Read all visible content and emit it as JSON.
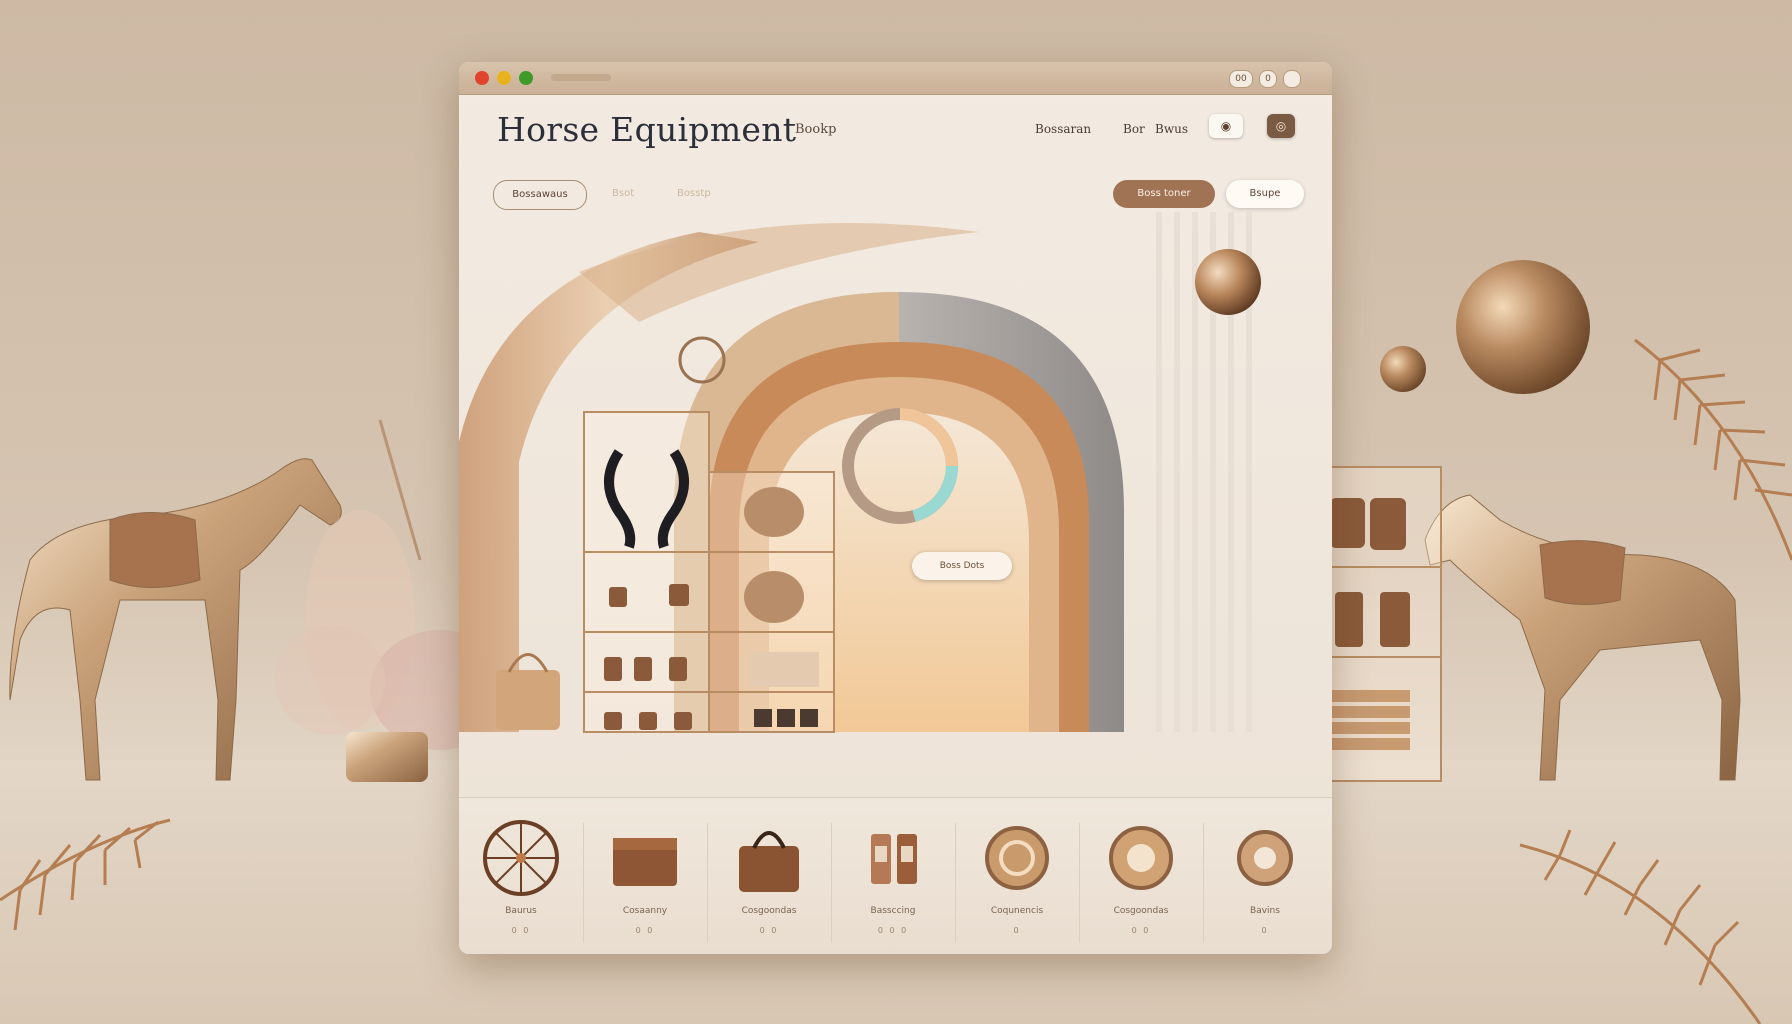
{
  "window": {
    "title": "",
    "controls": [
      "close",
      "minimize",
      "maximize"
    ],
    "toolbar_buttons": [
      {
        "label": "00",
        "icon": "tab-icon"
      },
      {
        "label": "0",
        "icon": "refresh-icon"
      },
      {
        "label": "",
        "icon": "menu-icon"
      }
    ]
  },
  "header": {
    "brand": "Horse Equipment",
    "brand_sub": "Bookp",
    "nav": [
      "Bossaran",
      "Bor",
      "Bwus"
    ],
    "icons": [
      "user-icon",
      "cart-icon"
    ]
  },
  "subnav": {
    "left_pill": "Bossawaus",
    "faint_links": [
      "Bsot",
      "Bosstp"
    ],
    "right_pill_primary": "Boss toner",
    "right_pill_secondary": "Bsupe"
  },
  "hero": {
    "cta_label": "Boss Dots"
  },
  "categories": [
    {
      "label": "Baurus",
      "pages": "0 0",
      "icon": "wheel-icon"
    },
    {
      "label": "Cosaanny",
      "pages": "0 0",
      "icon": "briefcase-icon"
    },
    {
      "label": "Cosgoondas",
      "pages": "0 0",
      "icon": "handbag-icon"
    },
    {
      "label": "Bassccing",
      "pages": "0 0 0",
      "icon": "bottle-icon"
    },
    {
      "label": "Coqunencis",
      "pages": "0",
      "icon": "medallion-icon"
    },
    {
      "label": "Cosgoondas",
      "pages": "0 0",
      "icon": "medallion-icon"
    },
    {
      "label": "Bavins",
      "pages": "0",
      "icon": "medallion-icon"
    }
  ],
  "colors": {
    "accent": "#a07354",
    "gold": "#c49a6c",
    "background": "#d6c5b2"
  }
}
